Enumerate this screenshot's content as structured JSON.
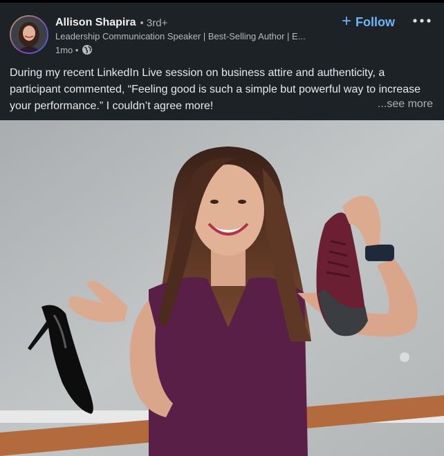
{
  "post": {
    "author": {
      "name": "Allison Shapira",
      "degree": "• 3rd+",
      "headline": "Leadership Communication Speaker | Best-Selling Author | E...",
      "time": "1mo •",
      "visibility_icon": "globe-icon"
    },
    "follow_label": "Follow",
    "more_icon": "ellipsis-icon",
    "body_text": "During my recent LinkedIn Live session on business attire and authenticity, a participant commented, “Feeling good is such a simple but powerful way to increase your performance.” I couldn’t agree more!",
    "see_more_label": "...see more",
    "image": {
      "description_icon": "post-photo",
      "colors": {
        "dress": "#5a1f46",
        "sneaker": "#6b1f32",
        "wall": "#b8bcbe"
      }
    }
  }
}
